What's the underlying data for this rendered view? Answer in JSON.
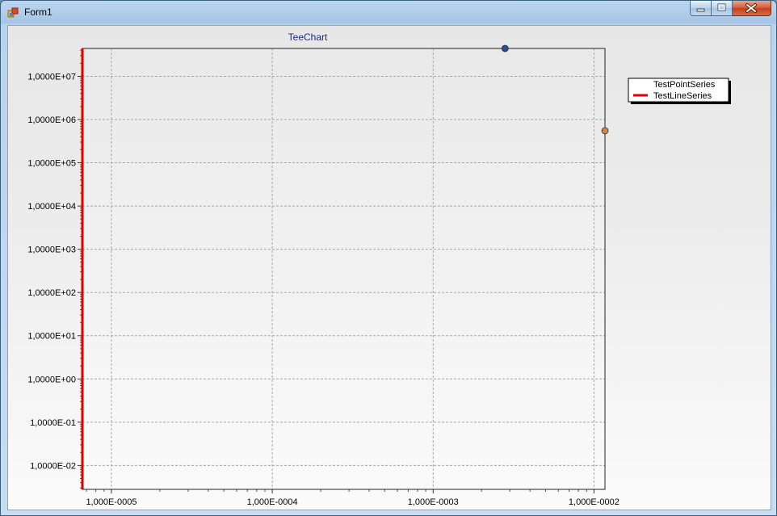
{
  "window": {
    "title": "Form1",
    "buttons": {
      "minimize": "minimize-icon",
      "maximize": "maximize-icon",
      "close": "close-icon"
    }
  },
  "chart_data": {
    "type": "scatter",
    "title": "TeeChart",
    "x_axis": {
      "scale": "log",
      "range": [
        6.6e-06,
        0.0117
      ],
      "ticks": [
        1e-05,
        0.0001,
        0.001,
        0.01
      ],
      "tick_labels": [
        "1,000E-0005",
        "1,000E-0004",
        "1,000E-0003",
        "1,000E-0002"
      ]
    },
    "y_axis": {
      "scale": "log",
      "range": [
        0.0028,
        44000000
      ],
      "ticks": [
        0.01,
        0.1,
        1,
        10,
        100,
        1000,
        10000,
        100000,
        1000000,
        10000000
      ],
      "tick_labels": [
        "1,0000E-02",
        "1,0000E-01",
        "1,0000E+00",
        "1,0000E+01",
        "1,0000E+02",
        "1,0000E+03",
        "1,0000E+04",
        "1,0000E+05",
        "1,0000E+06",
        "1,0000E+07"
      ]
    },
    "grid": true,
    "legend": {
      "placement": "top-right",
      "entries": [
        "TestPointSeries",
        "TestLineSeries"
      ]
    },
    "series": [
      {
        "name": "TestPointSeries",
        "kind": "points",
        "color": "#2b4f86",
        "points": [
          {
            "x": 0.0028,
            "y": 44000000
          }
        ]
      },
      {
        "name": "TestLineSeries",
        "kind": "line",
        "color": "#e00000",
        "points": [
          {
            "x": 6.6e-06,
            "y": 0.0028
          },
          {
            "x": 6.6e-06,
            "y": 44000000
          }
        ]
      },
      {
        "name": "",
        "kind": "points",
        "color": "#d0883a",
        "points": [
          {
            "x": 0.0117,
            "y": 550000
          }
        ]
      }
    ]
  }
}
